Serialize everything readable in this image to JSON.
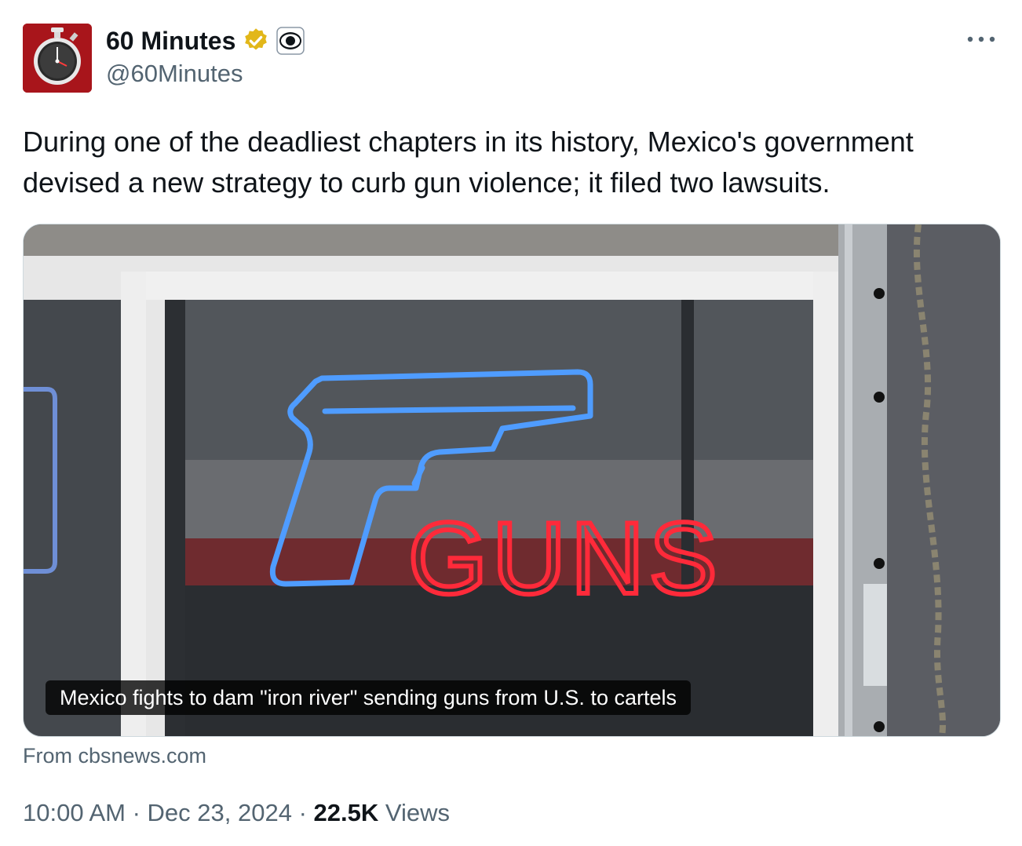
{
  "author": {
    "display_name": "60 Minutes",
    "handle": "@60Minutes",
    "verified_icon": "verified-badge-icon",
    "affiliate_icon": "cbs-eye-icon",
    "avatar_icon": "stopwatch-icon"
  },
  "tweet": {
    "text": "During one of the deadliest chapters in its history, Mexico's government devised a new strategy to curb gun violence; it filed two lawsuits."
  },
  "card": {
    "caption": "Mexico fights to dam \"iron river\" sending guns from U.S. to cartels",
    "source": "From cbsnews.com",
    "image_sign_text": "GUNS"
  },
  "footer": {
    "time": "10:00 AM",
    "sep1": " · ",
    "date": "Dec 23, 2024",
    "sep2": " · ",
    "views_count": "22.5K",
    "views_label": " Views"
  },
  "colors": {
    "brand_red": "#a8151b",
    "verified_gold": "#e2b719",
    "text_primary": "#0f1419",
    "text_secondary": "#536471",
    "neon_red": "#ff2a3a",
    "neon_blue": "#4f9cff"
  }
}
